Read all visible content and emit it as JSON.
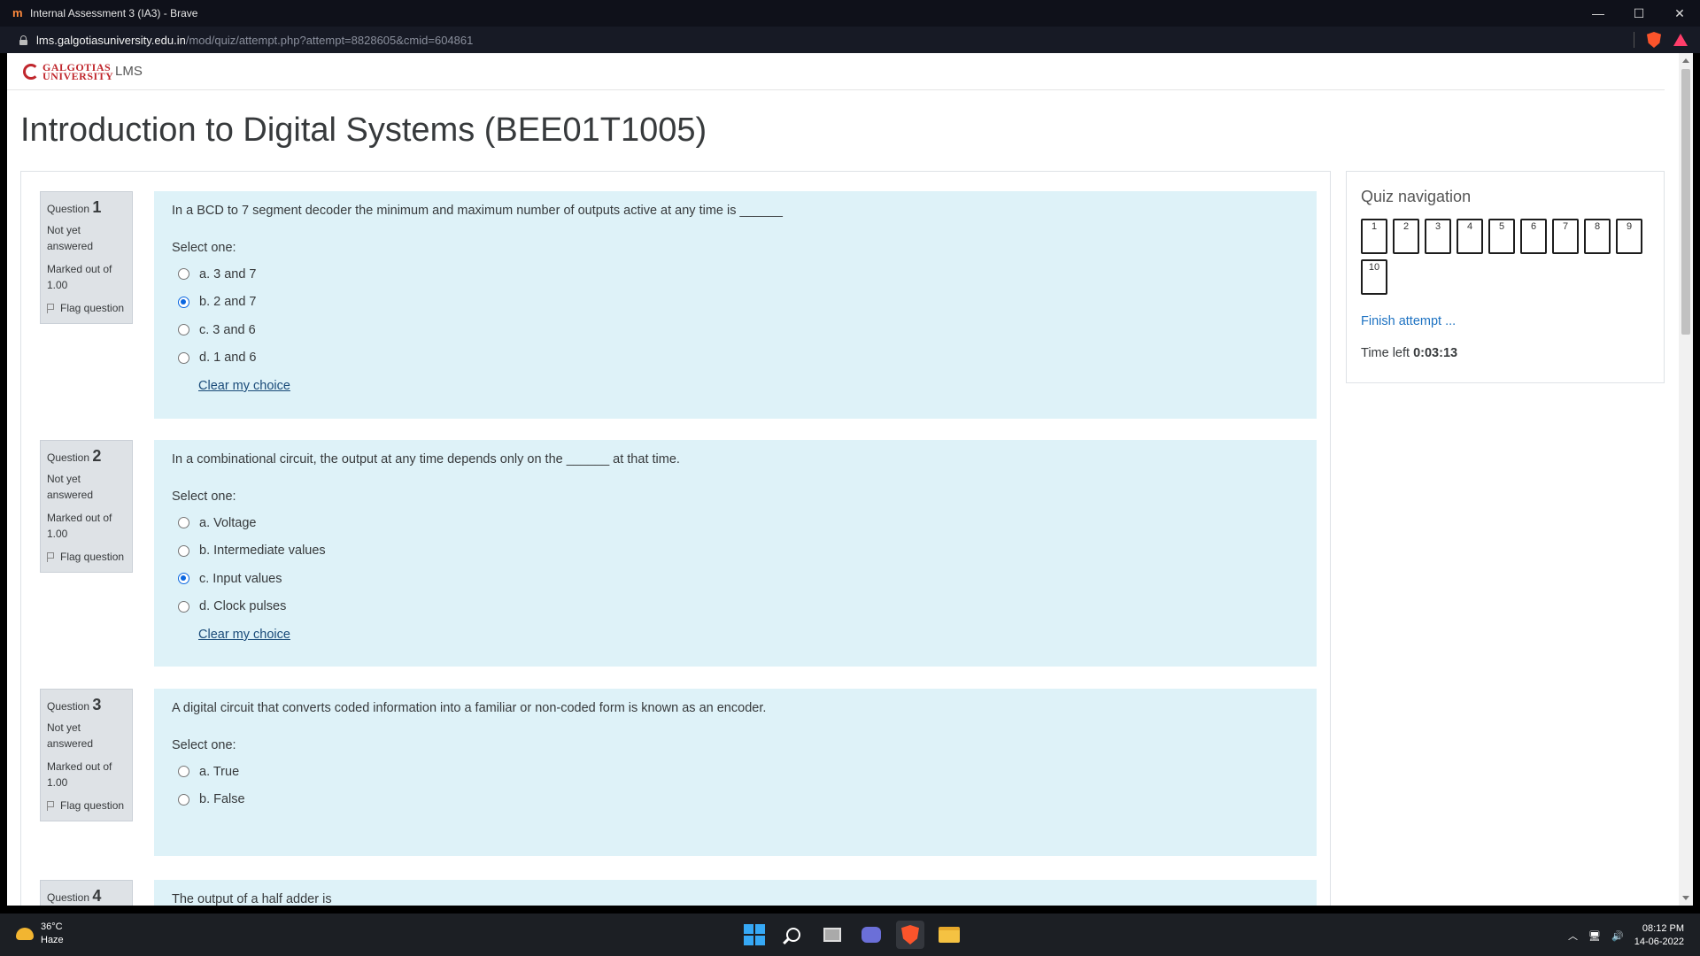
{
  "window": {
    "title": "Internal Assessment 3 (IA3) - Brave",
    "minimize": "—",
    "maximize": "☐",
    "close": "✕"
  },
  "address": {
    "host": "lms.galgotiasuniversity.edu.in",
    "path": "/mod/quiz/attempt.php?attempt=8828605&cmid=604861"
  },
  "site": {
    "logo_text": "GALGOTIAS UNIVERSITY",
    "lms_label": "LMS"
  },
  "page": {
    "title": "Introduction to Digital Systems (BEE01T1005)"
  },
  "questions": [
    {
      "label": "Question",
      "number": "1",
      "state": "Not yet answered",
      "grade": "Marked out of 1.00",
      "flag": "Flag question",
      "text": "In a BCD to 7 segment decoder the minimum and maximum number of outputs active at any time is ______",
      "prompt": "Select one:",
      "answers": [
        "a. 3 and 7",
        "b. 2 and 7",
        "c. 3 and 6",
        "d. 1 and 6"
      ],
      "selected_index": 1,
      "clear": "Clear my choice"
    },
    {
      "label": "Question",
      "number": "2",
      "state": "Not yet answered",
      "grade": "Marked out of 1.00",
      "flag": "Flag question",
      "text": "In a combinational circuit, the output at any time depends only on the ______ at that time.",
      "prompt": "Select one:",
      "answers": [
        "a. Voltage",
        "b. Intermediate values",
        "c. Input values",
        "d. Clock pulses"
      ],
      "selected_index": 2,
      "clear": "Clear my choice"
    },
    {
      "label": "Question",
      "number": "3",
      "state": "Not yet answered",
      "grade": "Marked out of 1.00",
      "flag": "Flag question",
      "text": "A digital circuit that converts coded information into a familiar or non-coded form is known as an encoder.",
      "prompt": "Select one:",
      "answers": [
        "a. True",
        "b. False"
      ],
      "selected_index": -1
    },
    {
      "label": "Question",
      "number": "4",
      "text": "The output of a half adder is"
    }
  ],
  "quiz_nav": {
    "title": "Quiz navigation",
    "buttons": [
      "1",
      "2",
      "3",
      "4",
      "5",
      "6",
      "7",
      "8",
      "9",
      "10"
    ],
    "finish": "Finish attempt ...",
    "time_label": "Time left",
    "time_value": "0:03:13"
  },
  "taskbar": {
    "temperature": "36°C",
    "weather": "Haze",
    "time": "08:12 PM",
    "date": "14-06-2022"
  }
}
